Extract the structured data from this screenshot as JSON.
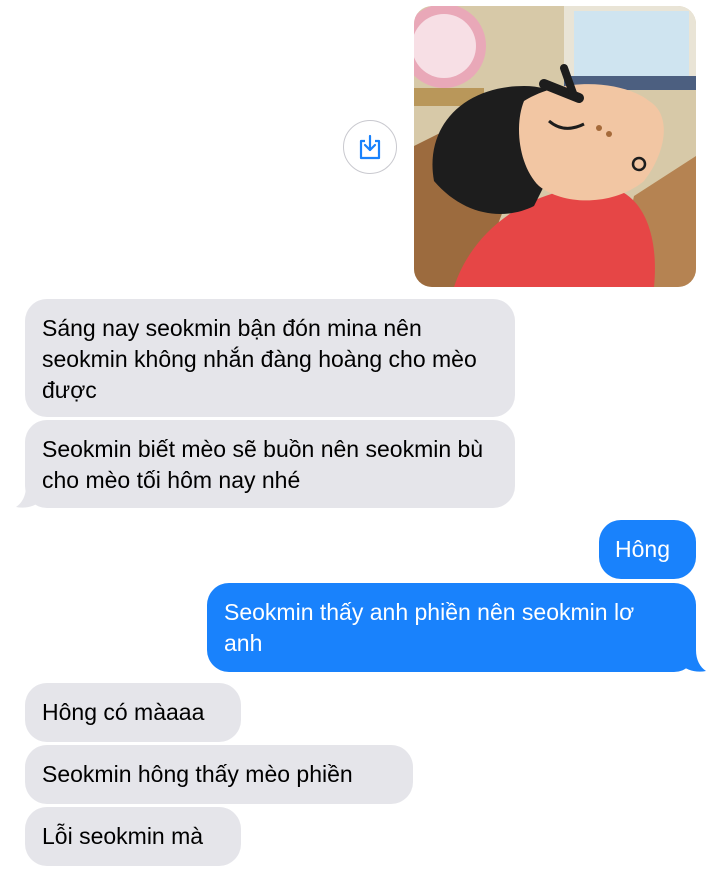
{
  "colors": {
    "incoming_bubble": "#e5e5ea",
    "outgoing_bubble": "#1982fc",
    "outgoing_text": "#ffffff",
    "incoming_text": "#000000"
  },
  "image_message": {
    "icon": "save-share-icon",
    "description_hidden": true
  },
  "messages": [
    {
      "direction": "incoming",
      "text": "Sáng nay seokmin bận đón mina nên seokmin không nhắn đàng hoàng cho mèo được"
    },
    {
      "direction": "incoming",
      "text": "Seokmin biết mèo sẽ buồn nên seokmin bù cho mèo tối hôm nay nhé"
    },
    {
      "direction": "outgoing",
      "text": "Hông"
    },
    {
      "direction": "outgoing",
      "text": "Seokmin thấy anh phiền nên seokmin lơ anh"
    },
    {
      "direction": "incoming",
      "text": "Hông có màaaa"
    },
    {
      "direction": "incoming",
      "text": "Seokmin hông thấy mèo phiền"
    },
    {
      "direction": "incoming",
      "text": "Lỗi seokmin mà"
    }
  ]
}
